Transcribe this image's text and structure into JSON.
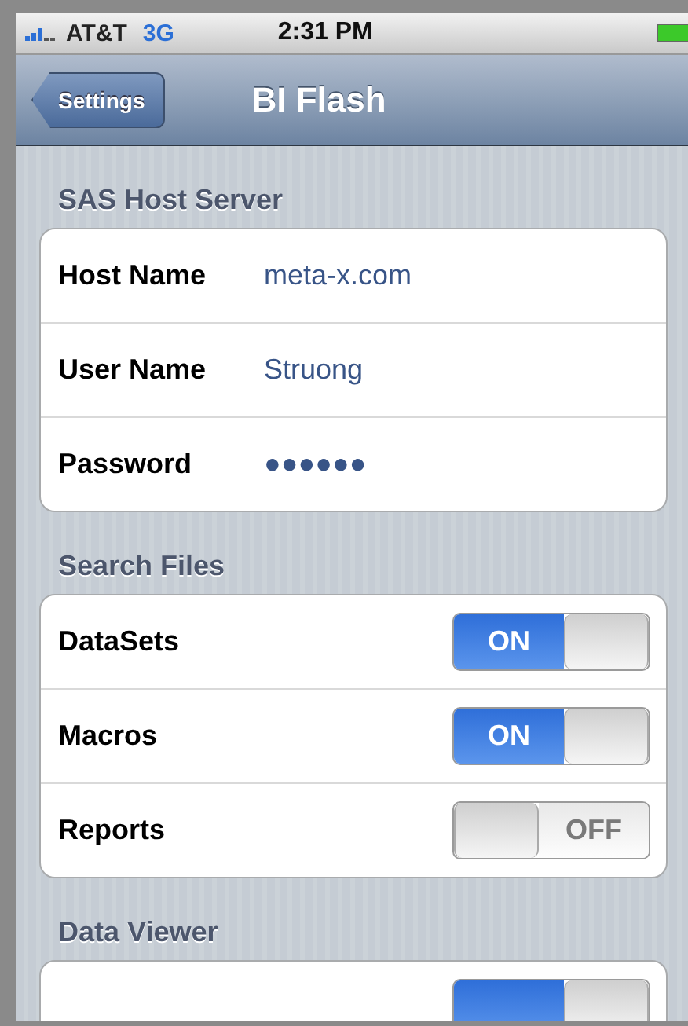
{
  "status_bar": {
    "carrier": "AT&T",
    "network": "3G",
    "time": "2:31 PM"
  },
  "nav_bar": {
    "back_button": "Settings",
    "title": "BI Flash"
  },
  "sections": [
    {
      "header": "SAS Host Server",
      "rows": [
        {
          "kind": "field",
          "label": "Host Name",
          "value": "meta-x.com"
        },
        {
          "kind": "field",
          "label": "User Name",
          "value": "Struong"
        },
        {
          "kind": "field",
          "label": "Password",
          "value": "●●●●●●"
        }
      ]
    },
    {
      "header": "Search Files",
      "rows": [
        {
          "kind": "switch",
          "label": "DataSets",
          "on": true,
          "state_text": "ON"
        },
        {
          "kind": "switch",
          "label": "Macros",
          "on": true,
          "state_text": "ON"
        },
        {
          "kind": "switch",
          "label": "Reports",
          "on": false,
          "state_text": "OFF"
        }
      ]
    },
    {
      "header": "Data Viewer",
      "rows": [
        {
          "kind": "switch",
          "on": true
        }
      ]
    }
  ]
}
